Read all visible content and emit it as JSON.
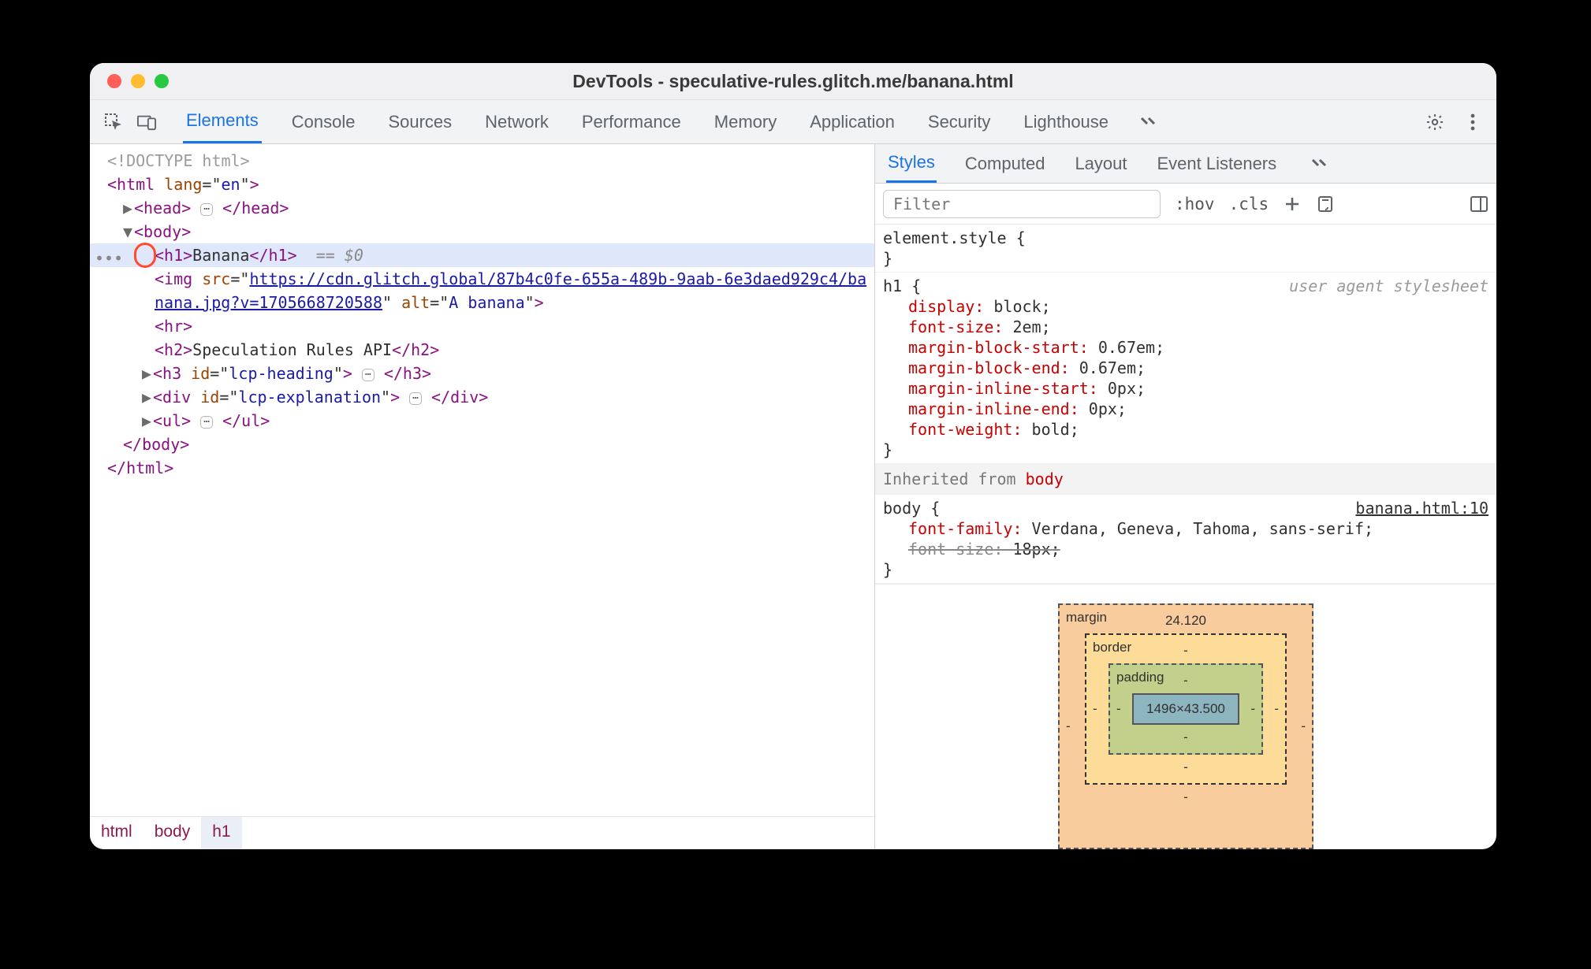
{
  "window": {
    "title": "DevTools - speculative-rules.glitch.me/banana.html"
  },
  "tabs": {
    "main": [
      "Elements",
      "Console",
      "Sources",
      "Network",
      "Performance",
      "Memory",
      "Application",
      "Security",
      "Lighthouse"
    ],
    "active": "Elements"
  },
  "dom": {
    "doctype": "<!DOCTYPE html>",
    "html_open": {
      "tag": "html",
      "attrs": [
        {
          "n": "lang",
          "v": "en"
        }
      ]
    },
    "head": {
      "tag": "head"
    },
    "body_open": {
      "tag": "body"
    },
    "selected": {
      "tagOpen": "<h1>",
      "text": "Banana",
      "tagClose": "</h1>",
      "marker": "== $0"
    },
    "img": {
      "srcA": "https://cdn.glitch.global/87b4c0fe-655a-489b-9aab-6e3daed929c4/ba",
      "srcB": "nana.jpg?v=1705668720588",
      "alt": "A banana"
    },
    "hr": "<hr>",
    "h2": {
      "open": "<h2>",
      "text": "Speculation Rules API",
      "close": "</h2>"
    },
    "h3": {
      "tag": "h3",
      "attrs": [
        {
          "n": "id",
          "v": "lcp-heading"
        }
      ]
    },
    "div": {
      "tag": "div",
      "attrs": [
        {
          "n": "id",
          "v": "lcp-explanation"
        }
      ]
    },
    "ul": {
      "tag": "ul"
    },
    "body_close": "</body>",
    "html_close": "</html>"
  },
  "crumbs": [
    "html",
    "body",
    "h1"
  ],
  "right_tabs": {
    "items": [
      "Styles",
      "Computed",
      "Layout",
      "Event Listeners"
    ],
    "active": "Styles"
  },
  "filter": {
    "placeholder": "Filter",
    "hov": ":hov",
    "cls": ".cls"
  },
  "styles": {
    "element_style": {
      "selector": "element.style",
      "props": []
    },
    "h1": {
      "selector": "h1",
      "stamp": "user agent stylesheet",
      "props": [
        {
          "n": "display",
          "v": "block"
        },
        {
          "n": "font-size",
          "v": "2em"
        },
        {
          "n": "margin-block-start",
          "v": "0.67em"
        },
        {
          "n": "margin-block-end",
          "v": "0.67em"
        },
        {
          "n": "margin-inline-start",
          "v": "0px"
        },
        {
          "n": "margin-inline-end",
          "v": "0px"
        },
        {
          "n": "font-weight",
          "v": "bold"
        }
      ]
    },
    "inherited_label": "Inherited from",
    "inherited_from": "body",
    "body": {
      "selector": "body",
      "source": "banana.html:10",
      "props": [
        {
          "n": "font-family",
          "v": "Verdana, Geneva, Tahoma, sans-serif",
          "strike": false
        },
        {
          "n": "font-size",
          "v": "18px",
          "strike": true
        }
      ]
    }
  },
  "boxmodel": {
    "margin": {
      "label": "margin",
      "top": "24.120",
      "right": "-",
      "bottom": "-",
      "left": "-"
    },
    "border": {
      "label": "border",
      "top": "-",
      "right": "-",
      "bottom": "-",
      "left": "-"
    },
    "padding": {
      "label": "padding",
      "top": "-",
      "right": "-",
      "bottom": "-",
      "left": "-"
    },
    "content": "1496×43.500"
  }
}
